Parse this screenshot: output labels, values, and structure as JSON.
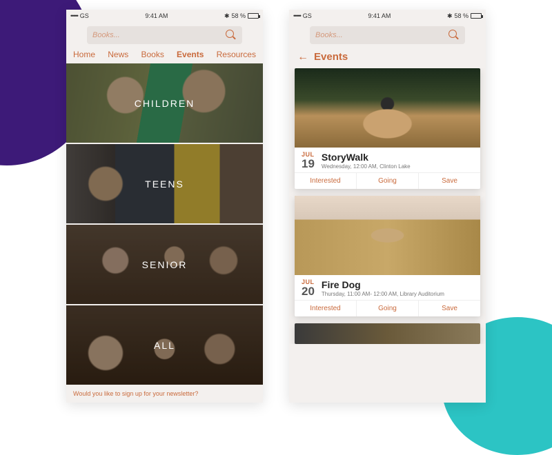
{
  "status": {
    "carrier": "GS",
    "signal_dots": "•••••",
    "time": "9:41 AM",
    "bt_glyph": "✱",
    "battery_pct": "58 %"
  },
  "search": {
    "placeholder": "Books..."
  },
  "tabs": [
    "Home",
    "News",
    "Books",
    "Events",
    "Resources"
  ],
  "tabs_active_index": 3,
  "categories": [
    "CHILDREN",
    "TEENS",
    "SENIOR",
    "ALL"
  ],
  "footer_text": "Would you like to sign up for your newsletter?",
  "events_header": {
    "title": "Events"
  },
  "events": [
    {
      "month": "JUL",
      "day": "19",
      "title": "StoryWalk",
      "subtitle": "Wednesday, 12:00 AM, Clinton Lake",
      "img_class": "img-forest"
    },
    {
      "month": "JUL",
      "day": "20",
      "title": "Fire Dog",
      "subtitle": "Thursday, 11:00 AM- 12:00 AM, Library Auditorium",
      "img_class": "img-field"
    }
  ],
  "actions": {
    "interested": "Interested",
    "going": "Going",
    "save": "Save"
  }
}
